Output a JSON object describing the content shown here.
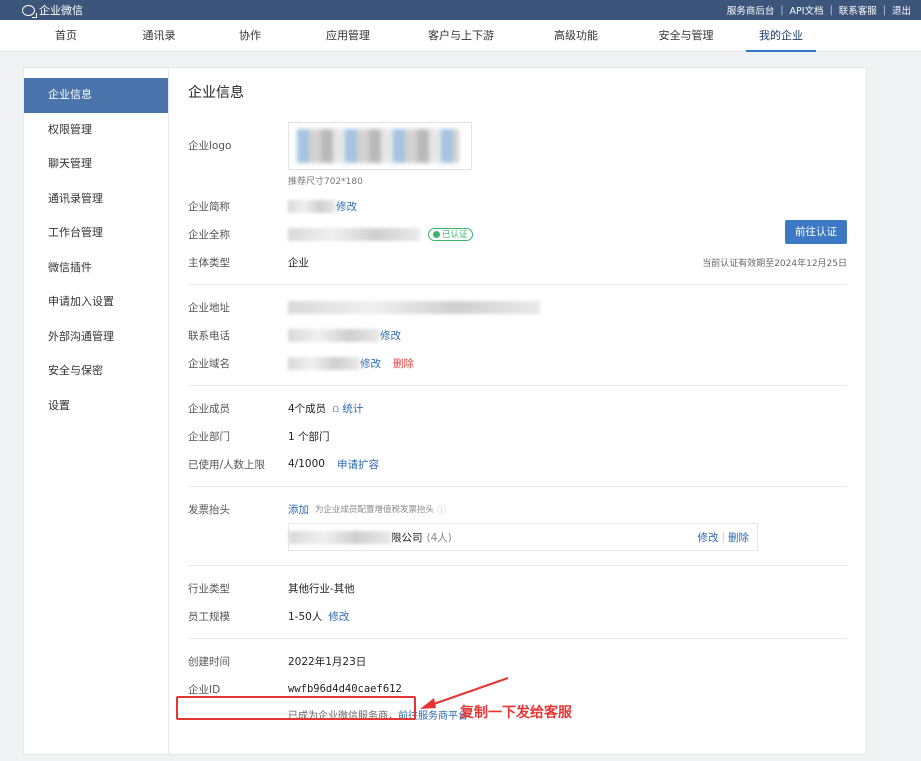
{
  "app": {
    "logo_text": "企业微信",
    "top_links": [
      "服务商后台",
      "API文档",
      "联系客服",
      "退出"
    ]
  },
  "nav": {
    "items": [
      "首页",
      "通讯录",
      "协作",
      "应用管理",
      "客户与上下游",
      "高级功能",
      "安全与管理",
      "我的企业"
    ],
    "active": "我的企业"
  },
  "sidebar": {
    "items": [
      "企业信息",
      "权限管理",
      "聊天管理",
      "通讯录管理",
      "工作台管理",
      "微信插件",
      "申请加入设置",
      "外部沟通管理",
      "安全与保密",
      "设置"
    ]
  },
  "main": {
    "title": "企业信息",
    "logo_label": "企业logo",
    "logo_hint": "推荐尺寸702*180",
    "short_name_label": "企业简称",
    "edit": "修改",
    "full_name_label": "企业全称",
    "verified_badge": "已认证",
    "verify_button": "前往认证",
    "entity_type_label": "主体类型",
    "entity_type_value": "企业",
    "expire_text": "当前认证有效期至2024年12月25日",
    "address_label": "企业地址",
    "phone_label": "联系电话",
    "domain_label": "企业域名",
    "delete": "删除",
    "members_label": "企业成员",
    "members_value": "4个成员",
    "stats_link": "统计",
    "depts_label": "企业部门",
    "depts_value": "1 个部门",
    "usage_label": "已使用/人数上限",
    "usage_value": "4/1000",
    "expand_link": "申请扩容",
    "invoice_label": "发票抬头",
    "invoice_add": "添加",
    "invoice_hint": "为企业成员配置增值税发票抬头",
    "invoice_company": "限公司",
    "invoice_count": "(4人)",
    "invoice_edit": "修改",
    "invoice_delete": "删除",
    "industry_label": "行业类型",
    "industry_value": "其他行业-其他",
    "scale_label": "员工规模",
    "scale_value": "1-50人",
    "created_label": "创建时间",
    "created_value": "2022年1月23日",
    "corp_id_label": "企业ID",
    "corp_id_value": "wwfb96d4d40caef612",
    "provider_text": "已成为企业微信服务商，",
    "provider_link": "前往服务商平台"
  },
  "annotation": {
    "text": "复制一下发给客服",
    "color": "#e53535"
  }
}
